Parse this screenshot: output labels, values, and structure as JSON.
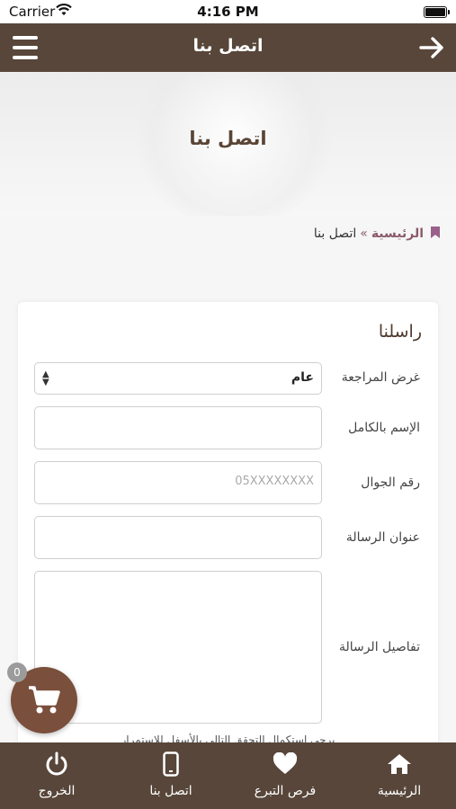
{
  "status": {
    "carrier": "Carrier",
    "time": "4:16 PM"
  },
  "navbar": {
    "title": "اتصل بنا"
  },
  "hero": {
    "heading": "اتصل بنا"
  },
  "breadcrumb": {
    "home": "الرئيسية",
    "separator": "»",
    "current": "اتصل بنا"
  },
  "form": {
    "title": "راسلنا",
    "purpose": {
      "label": "غرض المراجعة",
      "value": "عام"
    },
    "full_name": {
      "label": "الإسم بالكامل",
      "value": ""
    },
    "mobile": {
      "label": "رقم الجوال",
      "placeholder": "05XXXXXXXX"
    },
    "subject": {
      "label": "عنوان الرسالة",
      "value": ""
    },
    "details": {
      "label": "تفاصيل الرسالة",
      "value": ""
    },
    "note": "يرجى استكمال التحقق التالي بالأسفل للاستمرار"
  },
  "cart": {
    "count": "0"
  },
  "tabbar": {
    "home": "الرئيسية",
    "donate": "فرص التبرع",
    "contact": "اتصل بنا",
    "logout": "الخروج"
  },
  "colors": {
    "brand": "#574639",
    "accent": "#7a4f3b",
    "breadcrumb": "#8b5a6b"
  }
}
